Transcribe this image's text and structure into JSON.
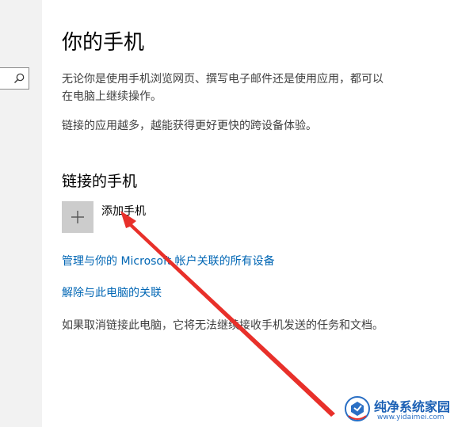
{
  "page": {
    "title": "你的手机",
    "description_line1": "无论你是使用手机浏览网页、撰写电子邮件还是使用应用，都可以",
    "description_line2": "在电脑上继续操作。",
    "description_line3": "链接的应用越多，越能获得更好更快的跨设备体验。"
  },
  "linked_phones": {
    "section_title": "链接的手机",
    "add_phone_label": "添加手机",
    "add_icon": "plus-icon"
  },
  "links": {
    "manage_devices": "管理与你的 Microsoft 帐户关联的所有设备",
    "unlink_pc": "解除与此电脑的关联"
  },
  "note": "如果取消链接此电脑，它将无法继续接收手机发送的任务和文档。",
  "sidebar": {
    "search_icon": "search-icon"
  },
  "watermark": {
    "name": "纯净系统家园",
    "url": "www.yidaimei.com"
  },
  "colors": {
    "link": "#0066b4",
    "annotation_arrow": "#e8302a",
    "tile": "#cccccc",
    "sidebar_bg": "#f2f2f2"
  }
}
